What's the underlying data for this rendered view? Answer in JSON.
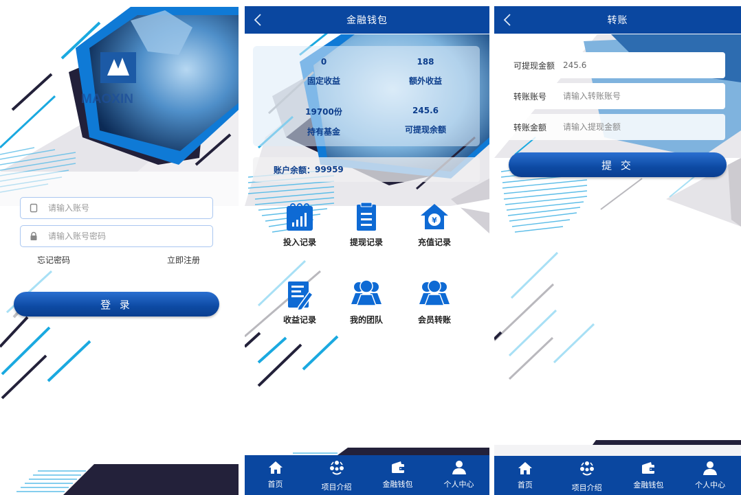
{
  "login": {
    "logo_text": "MAOXIN",
    "account_placeholder": "请输入账号",
    "password_placeholder": "请输入账号密码",
    "forgot_label": "忘记密码",
    "register_label": "立即注册",
    "login_button": "登 录",
    "icons": {
      "account": "phone-icon",
      "password": "lock-icon"
    }
  },
  "wallet": {
    "title": "金融钱包",
    "stats": [
      {
        "value": "0",
        "label": "固定收益"
      },
      {
        "value": "188",
        "label": "额外收益"
      },
      {
        "value": "19700份",
        "label": "持有基金"
      },
      {
        "value": "245.6",
        "label": "可提现余额"
      }
    ],
    "balance_label": "账户余额：",
    "balance_value": "99959",
    "actions": [
      {
        "label": "投入记录",
        "icon": "chart-calendar-icon"
      },
      {
        "label": "提现记录",
        "icon": "clipboard-icon"
      },
      {
        "label": "充值记录",
        "icon": "house-yen-icon"
      },
      {
        "label": "收益记录",
        "icon": "edit-document-icon"
      },
      {
        "label": "我的团队",
        "icon": "team-icon"
      },
      {
        "label": "会员转账",
        "icon": "team-icon"
      }
    ]
  },
  "transfer": {
    "title": "转账",
    "fields": [
      {
        "label": "可提现金额",
        "value": "245.6"
      },
      {
        "label": "转账账号",
        "placeholder": "请输入转账账号"
      },
      {
        "label": "转账金额",
        "placeholder": "请输入提现金额"
      }
    ],
    "submit_button": "提 交"
  },
  "nav": [
    {
      "label": "首页",
      "icon": "home-icon"
    },
    {
      "label": "项目介绍",
      "icon": "network-icon"
    },
    {
      "label": "金融钱包",
      "icon": "wallet-icon"
    },
    {
      "label": "个人中心",
      "icon": "user-icon"
    }
  ],
  "colors": {
    "primary": "#0a47a0",
    "accent": "#1aa9e0",
    "dark": "#23213a",
    "stat_text": "#0d3e8c"
  }
}
